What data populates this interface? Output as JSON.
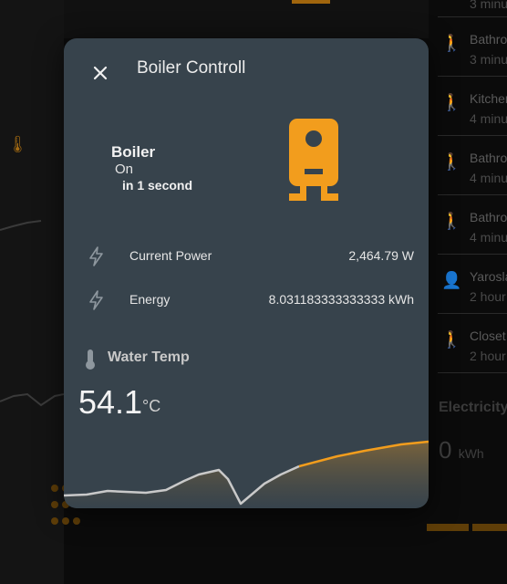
{
  "background": {
    "right_list": [
      {
        "name": "",
        "time": "3 minu",
        "icon": "walking-person-icon",
        "active": false
      },
      {
        "name": "Bathro",
        "time": "3 minu",
        "icon": "walking-person-icon",
        "active": false
      },
      {
        "name": "Kitchen",
        "time": "4 minu",
        "icon": "walking-person-icon",
        "active": false
      },
      {
        "name": "Bathro",
        "time": "4 minu",
        "icon": "walking-person-icon",
        "active": true
      },
      {
        "name": "Bathro",
        "time": "4 minu",
        "icon": "walking-person-icon",
        "active": false
      },
      {
        "name": "Yarosla",
        "time": "2 hour",
        "icon": "person-icon",
        "active": false
      },
      {
        "name": "Closet",
        "time": "2 hour",
        "icon": "walking-person-icon",
        "active": false
      }
    ],
    "electricity_title": "Electricity",
    "electricity_value": "0",
    "electricity_unit": "kWh"
  },
  "dialog": {
    "title": "Boiler Controll",
    "entity": {
      "name": "Boiler",
      "state": "On",
      "last_changed": "in 1 second",
      "icon": "water-boiler-icon"
    },
    "sensors": [
      {
        "icon": "lightning-bolt-icon",
        "label": "Current Power",
        "value": "2,464.79 W"
      },
      {
        "icon": "lightning-bolt-icon",
        "label": "Energy",
        "value": "8.031183333333333 kWh"
      }
    ],
    "water_temp": {
      "title": "Water Temp",
      "value": "54.1",
      "unit": "°C",
      "icon": "thermometer-icon"
    }
  },
  "colors": {
    "accent": "#f29d1d",
    "dialog_bg": "#37434c",
    "chart_line_past": "#c9c9c9",
    "chart_line_recent": "#f29d1d"
  }
}
